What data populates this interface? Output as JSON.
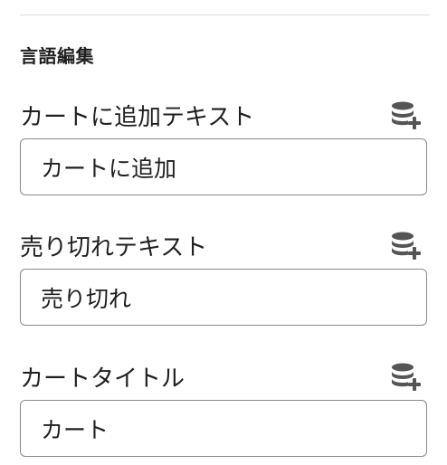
{
  "section": {
    "title": "言語編集"
  },
  "fields": [
    {
      "label": "カートに追加テキスト",
      "value": "カートに追加",
      "icon": "database-add-icon"
    },
    {
      "label": "売り切れテキスト",
      "value": "売り切れ",
      "icon": "database-add-icon"
    },
    {
      "label": "カートタイトル",
      "value": "カート",
      "icon": "database-add-icon"
    }
  ],
  "colors": {
    "text": "#1f1f1f",
    "border": "#8a8a8a",
    "divider": "#dcdcdc",
    "icon": "#555555"
  }
}
